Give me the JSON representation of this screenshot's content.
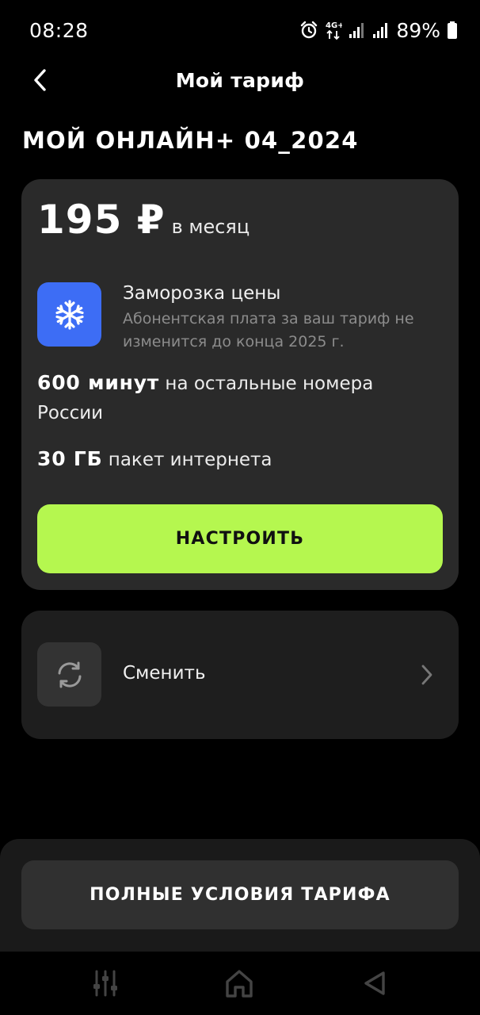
{
  "status_bar": {
    "time": "08:28",
    "network": "4G+",
    "battery": "89%",
    "icons": [
      "alarm-icon",
      "network-4g-icon",
      "signal-icon",
      "signal-icon",
      "battery-icon"
    ]
  },
  "header": {
    "title": "Мой тариф",
    "back_icon": "chevron-left-icon"
  },
  "tariff": {
    "name": "МОЙ ОНЛАЙН+ 04_2024",
    "price": "195 ₽",
    "period": "в месяц",
    "freeze": {
      "icon": "snowflake-icon",
      "title": "Заморозка цены",
      "description": "Абонентская плата за ваш тариф не изменится до конца 2025 г."
    },
    "minutes": {
      "value": "600 минут",
      "text": "на остальные номера России"
    },
    "data": {
      "value": "30 ГБ",
      "text": "пакет интернета"
    },
    "configure_label": "НАСТРОИТЬ"
  },
  "change": {
    "icon": "refresh-icon",
    "label": "Сменить",
    "chevron_icon": "chevron-right-icon"
  },
  "bottom": {
    "full_terms_label": "ПОЛНЫЕ УСЛОВИЯ ТАРИФА"
  },
  "nav": {
    "items": [
      "recents-icon",
      "home-icon",
      "back-triangle-icon"
    ]
  },
  "colors": {
    "background": "#000000",
    "card": "#2a2a2a",
    "accent_green": "#b5f74f",
    "freeze_blue": "#3d6df5",
    "muted_text": "#8c8c8c"
  }
}
